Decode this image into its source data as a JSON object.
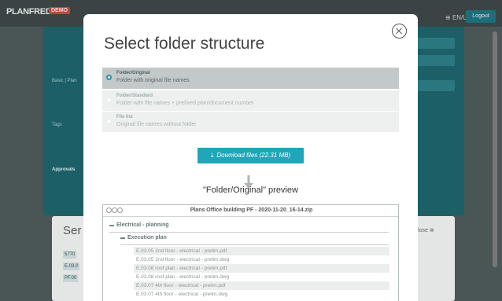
{
  "app": {
    "logo_text": "PLANFRED",
    "demo_badge": "DEMO",
    "language": "EN/US",
    "logout_label": "Logout",
    "labels": [
      "Basic | Plan",
      "Tags",
      "Approvals"
    ],
    "lower_title": "Ser",
    "lower_tags": [
      "5770",
      "E.03.0",
      "PF.00"
    ],
    "lower_close": "Close"
  },
  "modal": {
    "title": "Select folder structure",
    "options": [
      {
        "title": "Folder/Original",
        "desc": "Folder with original file names",
        "selected": true
      },
      {
        "title": "Folder/Standard",
        "desc": "Folder with file names + prefixed plan/document number",
        "selected": false
      },
      {
        "title": "File list",
        "desc": "Original file names without folder",
        "selected": false
      }
    ],
    "download_label": "Download files (22.31 MB)",
    "preview_label": "\"Folder/Original\" preview",
    "window_title": "Plans Office building PF - 2020-11-20_16-14.zip",
    "folder_root": "Electrical - planning",
    "folder_sub": "Execution plan",
    "files": [
      "E.03.05 2nd floor - electrical - prelim.pdf",
      "E.03.05 2nd floor - electrical - prelim.dwg",
      "E.03.08 roof plan - electrical - prelim.pdf",
      "E.03.08 roof plan - electrical - prelim.dwg",
      "E.03.07 4th floor - electrical - prelim.pdf",
      "E.03.07 4th floor - electrical - prelim.dwg"
    ]
  }
}
